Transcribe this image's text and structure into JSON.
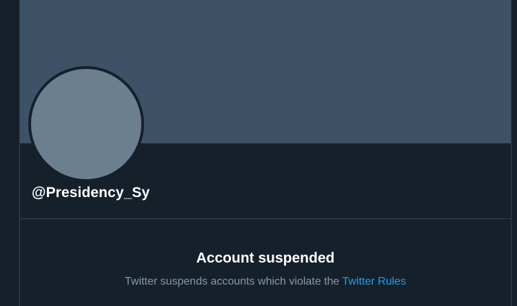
{
  "profile": {
    "handle": "@Presidency_Sy"
  },
  "suspension": {
    "title": "Account suspended",
    "message": "Twitter suspends accounts which violate the",
    "rules_link": "Twitter Rules"
  },
  "colors": {
    "background": "#15202b",
    "banner": "#3d5266",
    "avatar": "#6b7f8e",
    "link": "#1da1f2",
    "muted_text": "#8899a6",
    "divider": "#38444d"
  }
}
